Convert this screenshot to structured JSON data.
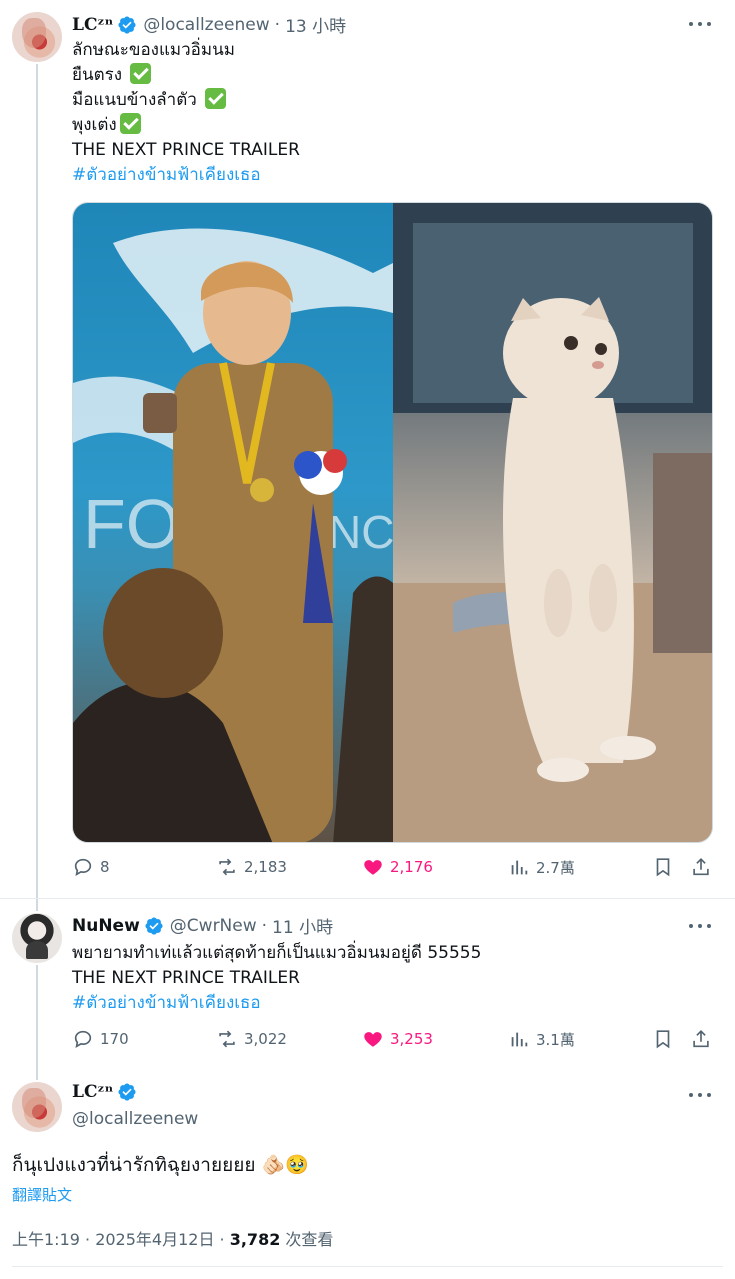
{
  "tweets": [
    {
      "display_name": "LCᶻⁿ",
      "handle": "@locallzeenew",
      "time": "13 小時",
      "lines": [
        "ลักษณะของแมวอิ่มนม",
        "ยืนตรง",
        "มือแนบข้างลำตัว",
        "พุงเต่ง",
        "THE NEXT PRINCE TRAILER"
      ],
      "hashtag": "#ตัวอย่างข้ามฟ้าเคียงเธอ",
      "stats": {
        "replies": "8",
        "reposts": "2,183",
        "likes": "2,176",
        "views": "2.7萬"
      }
    },
    {
      "display_name": "NuNew",
      "handle": "@CwrNew",
      "time": "11 小時",
      "lines": [
        "พยายามทำเท่แล้วแต่สุดท้ายก็เป็นแมวอิ่มนมอยู่ดี 55555",
        "THE NEXT PRINCE TRAILER"
      ],
      "hashtag": "#ตัวอย่างข้ามฟ้าเคียงเธอ",
      "stats": {
        "replies": "170",
        "reposts": "3,022",
        "likes": "3,253",
        "views": "3.1萬"
      }
    },
    {
      "display_name": "LCᶻⁿ",
      "handle": "@locallzeenew",
      "text": "ก็นุเปงแงวที่น่ารักทิฉุยงายยยย 🫵🏻🥹",
      "translate": "翻譯貼文",
      "timestamp": "上午1:19 · 2025年4月12日 · ",
      "views_count": "3,782",
      "views_label": " 次查看"
    }
  ],
  "colors": {
    "accent": "#1d9bf0",
    "like": "#f91880",
    "muted": "#536471",
    "check": "#66bb42"
  },
  "icons": [
    "reply-icon",
    "repost-icon",
    "heart-icon",
    "views-icon",
    "bookmark-icon",
    "share-icon",
    "verified-icon",
    "more-icon"
  ]
}
